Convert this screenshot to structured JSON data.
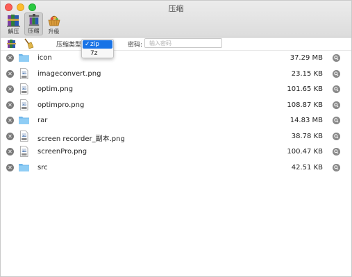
{
  "window": {
    "title": "压缩"
  },
  "toolbar": {
    "items": [
      {
        "label": "解压",
        "icon": "rar-books-icon"
      },
      {
        "label": "压缩",
        "icon": "compress-vise-icon",
        "active": true
      },
      {
        "label": "升级",
        "icon": "upgrade-basket-icon"
      }
    ]
  },
  "options": {
    "type_label": "压缩类型:",
    "type_options": [
      "zip",
      "7z"
    ],
    "type_selected": "zip",
    "password_label": "密码:",
    "password_placeholder": "输入密码",
    "password_value": ""
  },
  "files": [
    {
      "name": "icon",
      "size": "37.29 MB",
      "kind": "folder"
    },
    {
      "name": "imageconvert.png",
      "size": "23.15 KB",
      "kind": "png"
    },
    {
      "name": "optim.png",
      "size": "101.65 KB",
      "kind": "png"
    },
    {
      "name": "optimpro.png",
      "size": "108.87 KB",
      "kind": "png"
    },
    {
      "name": "rar",
      "size": "14.83 MB",
      "kind": "folder"
    },
    {
      "name": "screen recorder_副本.png",
      "size": "38.78 KB",
      "kind": "png"
    },
    {
      "name": "screenPro.png",
      "size": "100.47 KB",
      "kind": "png"
    },
    {
      "name": "src",
      "size": "42.51 KB",
      "kind": "folder"
    }
  ],
  "colors": {
    "selection": "#1873e6",
    "folder": "#7fc3f2",
    "remove_button": "#7b7b7b"
  }
}
